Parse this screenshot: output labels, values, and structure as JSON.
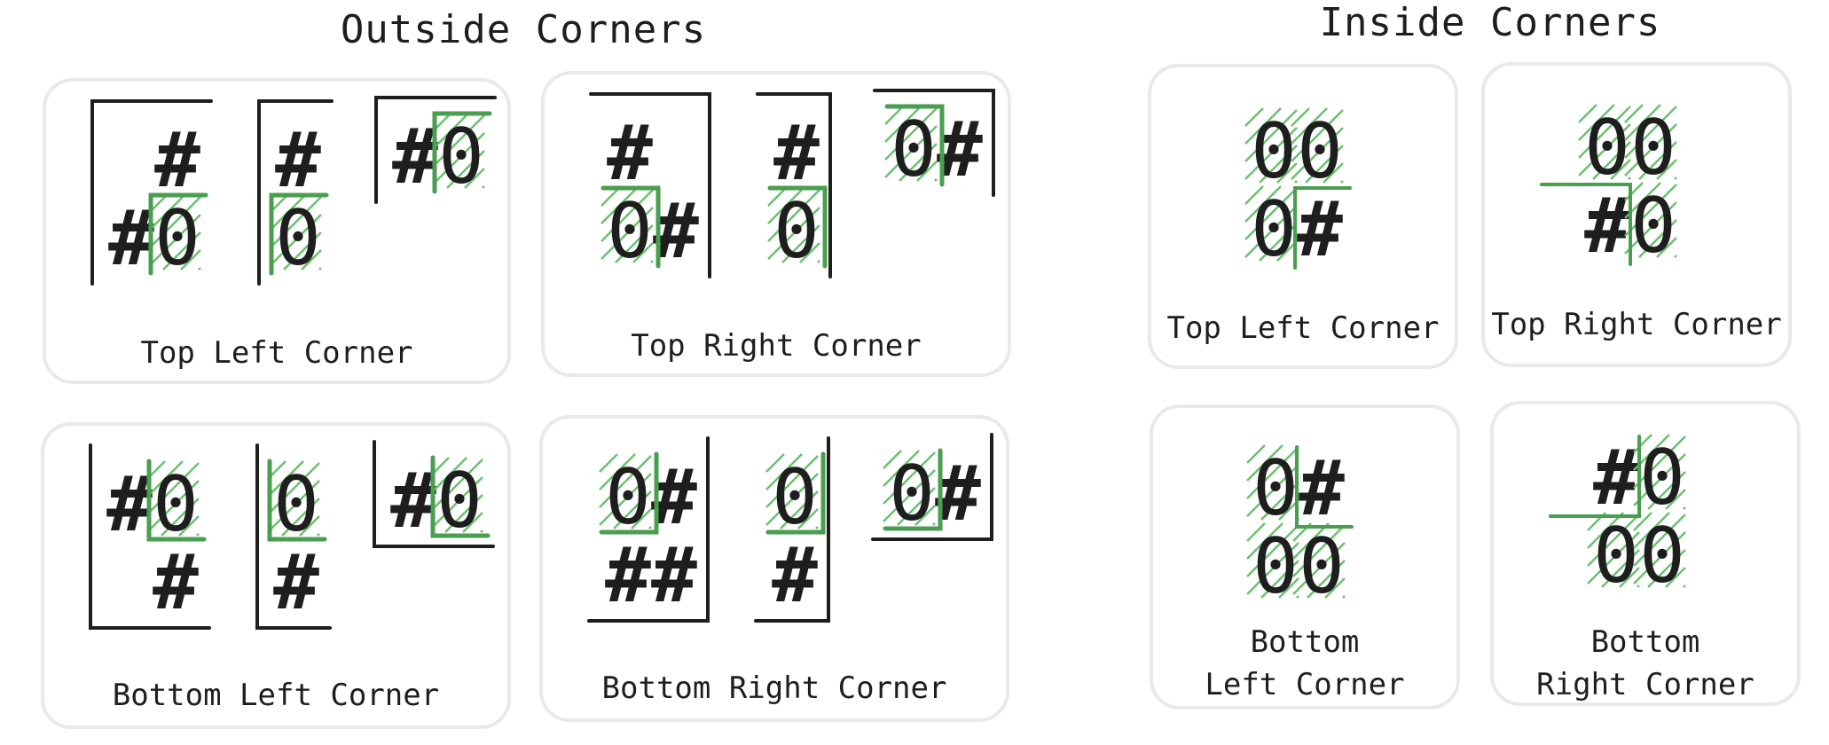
{
  "colors": {
    "ink": "#1e1e1e",
    "accent": "#4a9e4f",
    "hatch": "#6cc070",
    "panel_border": "#e9e9e9"
  },
  "sections": {
    "outside": {
      "title": "Outside Corners"
    },
    "inside": {
      "title": "Inside Corners"
    }
  },
  "panels": {
    "outside_top_left": {
      "label": "Top Left Corner",
      "examples": [
        {
          "rows": [
            " #",
            "#0"
          ]
        },
        {
          "rows": [
            "#",
            "0"
          ]
        },
        {
          "rows": [
            "#0"
          ]
        }
      ]
    },
    "outside_top_right": {
      "label": "Top Right Corner",
      "examples": [
        {
          "rows": [
            "# ",
            "0#"
          ]
        },
        {
          "rows": [
            "#",
            "0"
          ]
        },
        {
          "rows": [
            "0#"
          ]
        }
      ]
    },
    "outside_bottom_left": {
      "label": "Bottom Left Corner",
      "examples": [
        {
          "rows": [
            "#0",
            " #"
          ]
        },
        {
          "rows": [
            "0",
            "#"
          ]
        },
        {
          "rows": [
            "#0"
          ]
        }
      ]
    },
    "outside_bottom_right": {
      "label": "Bottom Right Corner",
      "examples": [
        {
          "rows": [
            "0#",
            "##"
          ]
        },
        {
          "rows": [
            "0",
            "#"
          ]
        },
        {
          "rows": [
            "0#"
          ]
        }
      ]
    },
    "inside_top_left": {
      "label": "Top Left Corner",
      "rows": [
        "00",
        "0#"
      ]
    },
    "inside_top_right": {
      "label": "Top Right Corner",
      "rows": [
        "00",
        "#0"
      ]
    },
    "inside_bottom_left": {
      "label": "Bottom\nLeft Corner",
      "rows": [
        "0#",
        "00"
      ]
    },
    "inside_bottom_right": {
      "label": "Bottom\nRight Corner",
      "rows": [
        "#0",
        "00"
      ]
    }
  }
}
